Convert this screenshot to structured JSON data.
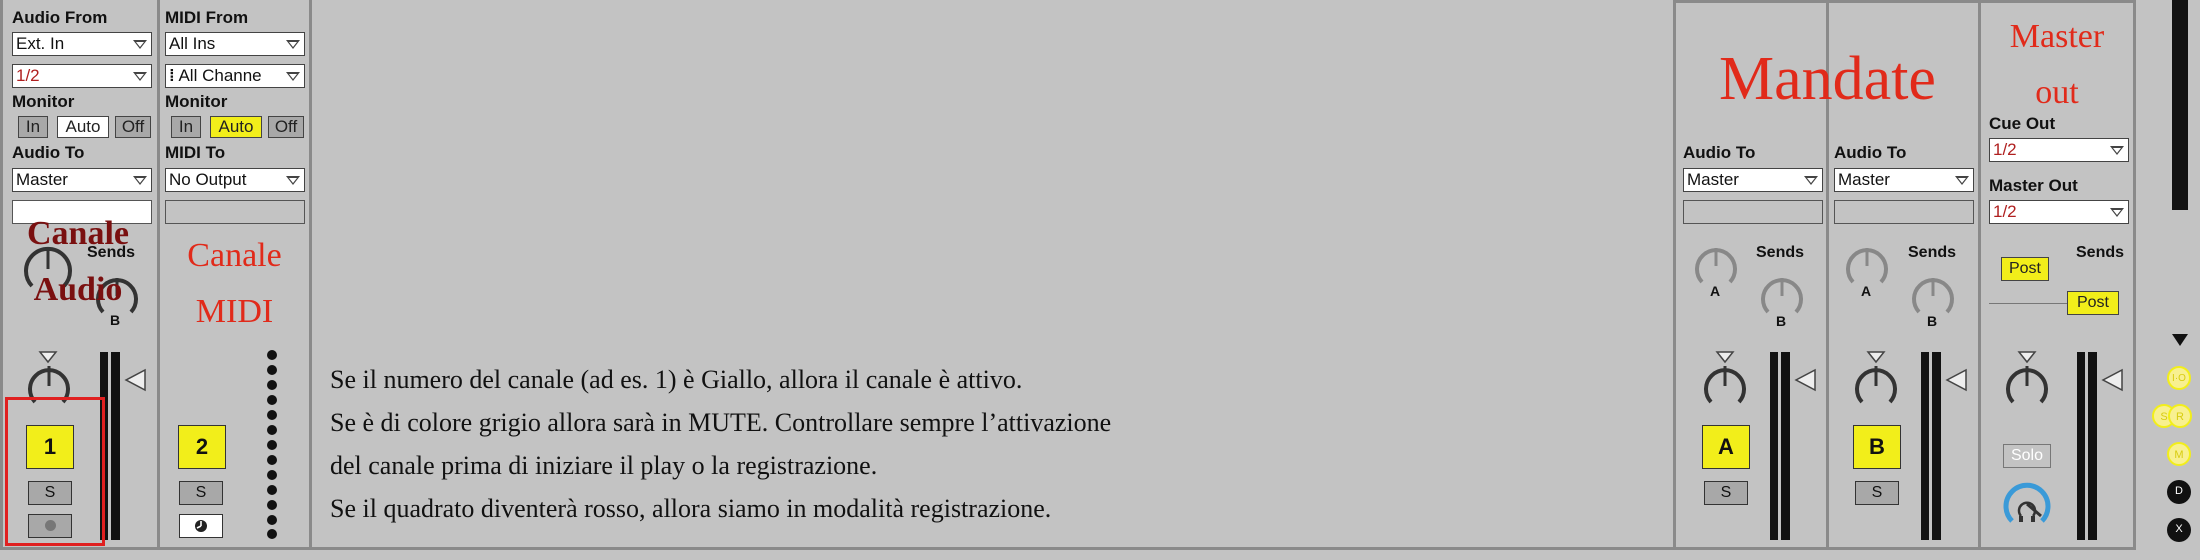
{
  "channels": [
    {
      "from_label": "Audio From",
      "from_value": "Ext. In",
      "sub_value": "1/2",
      "monitor_label": "Monitor",
      "monitor_buttons": [
        "In",
        "Auto",
        "Off"
      ],
      "to_label": "Audio To",
      "to_value": "Master",
      "sends_label": "Sends",
      "knob_labels": [
        "B"
      ],
      "number": "1",
      "solo": "S",
      "overlay_lines": [
        "Canale",
        "Audio"
      ]
    },
    {
      "from_label": "MIDI From",
      "from_value": "All Ins",
      "sub_value": "All Channe",
      "monitor_label": "Monitor",
      "monitor_buttons": [
        "In",
        "Auto",
        "Off"
      ],
      "to_label": "MIDI To",
      "to_value": "No Output",
      "number": "2",
      "solo": "S",
      "overlay_lines": [
        "Canale",
        "MIDI"
      ]
    }
  ],
  "notes": [
    "Se il numero del canale (ad es. 1) è Giallo, allora il canale è attivo.",
    "Se è di colore grigio allora sarà in MUTE. Controllare sempre l’attivazione",
    "del canale prima di iniziare il play o la registrazione.",
    "Se il quadrato diventerà rosso, allora siamo in modalità registrazione."
  ],
  "returns": [
    {
      "to_label": "Audio To",
      "to_value": "Master",
      "sends_label": "Sends",
      "knob_labels": [
        "A",
        "B"
      ],
      "letter": "A",
      "solo": "S"
    },
    {
      "to_label": "Audio To",
      "to_value": "Master",
      "sends_label": "Sends",
      "knob_labels": [
        "A",
        "B"
      ],
      "letter": "B",
      "solo": "S"
    }
  ],
  "returns_overlay": "Mandate",
  "master": {
    "overlay_lines": [
      "Master",
      "out"
    ],
    "cue_label": "Cue Out",
    "cue_value": "1/2",
    "master_out_label": "Master Out",
    "master_out_value": "1/2",
    "sends_label": "Sends",
    "post_buttons": [
      "Post",
      "Post"
    ],
    "solo": "Solo"
  },
  "side_buttons": [
    "I·O",
    "S",
    "R",
    "M",
    "D",
    "X"
  ],
  "colors": {
    "background": "#c3c3c3",
    "active_yellow": "#f2ee1a",
    "overlay_red": "#e12a1a",
    "overlay_dark_red": "#7a1010",
    "highlight_box": "#e02020",
    "knob_blue": "#3a9ad8"
  }
}
